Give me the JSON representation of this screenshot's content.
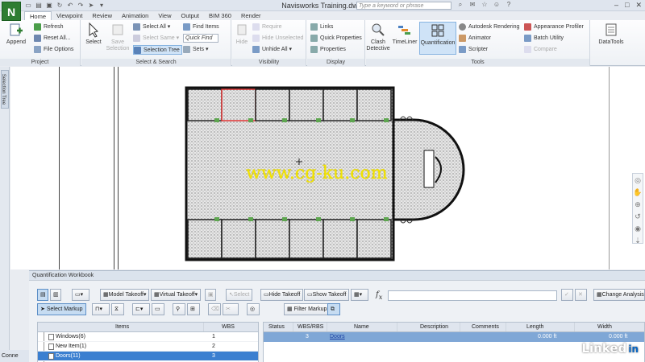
{
  "window": {
    "title": "Navisworks Training.dwfx",
    "search_placeholder": "Type a keyword or phrase",
    "app_letter": "N"
  },
  "tabs": [
    "Home",
    "Viewpoint",
    "Review",
    "Animation",
    "View",
    "Output",
    "BIM 360",
    "Render"
  ],
  "ribbon": {
    "project": {
      "label": "Project",
      "append": "Append",
      "refresh": "Refresh",
      "reset_all": "Reset All...",
      "file_options": "File Options"
    },
    "select_search": {
      "label": "Select & Search",
      "select": "Select",
      "save_selection": "Save Selection",
      "select_all": "Select All",
      "select_same": "Select Same",
      "selection_tree": "Selection Tree",
      "find_items": "Find Items",
      "quick_find": "Quick Find",
      "sets": "Sets"
    },
    "visibility": {
      "label": "Visibility",
      "hide": "Hide",
      "require": "Require",
      "hide_unselected": "Hide Unselected",
      "unhide_all": "Unhide All"
    },
    "display": {
      "label": "Display",
      "links": "Links",
      "quick_properties": "Quick Properties",
      "properties": "Properties"
    },
    "tools": {
      "label": "Tools",
      "clash_detective": "Clash Detective",
      "timeliner": "TimeLiner",
      "quantification": "Quantification",
      "autodesk_rendering": "Autodesk Rendering",
      "animator": "Animator",
      "scripter": "Scripter",
      "appearance_profiler": "Appearance Profiler",
      "batch_utility": "Batch Utility",
      "compare": "Compare",
      "datatools": "DataTools"
    }
  },
  "left_panel": {
    "selection_tree_tab": "Selection Tree"
  },
  "viewport": {
    "watermark": "www.cg-ku.com"
  },
  "workbook": {
    "title": "Quantification Workbook",
    "toolbar": {
      "model_takeoff": "Model Takeoff",
      "virtual_takeoff": "Virtual Takeoff",
      "select": "Select",
      "hide_takeoff": "Hide Takeoff",
      "show_takeoff": "Show Takeoff",
      "change_analysis": "Change Analysis",
      "select_markup": "Select Markup",
      "filter_markup": "Filter Markup"
    },
    "items_table": {
      "headers": [
        "Items",
        "WBS"
      ],
      "rows": [
        {
          "name": "Windows(6)",
          "wbs": "1"
        },
        {
          "name": "New Item(1)",
          "wbs": "2"
        },
        {
          "name": "Doors(11)",
          "wbs": "3"
        }
      ]
    },
    "detail_table": {
      "headers": [
        "Status",
        "WBS/RBS",
        "Name",
        "Description",
        "Comments",
        "Length",
        "Width"
      ],
      "rows": [
        {
          "status": "",
          "wbs": "3",
          "name": "Doors",
          "description": "",
          "comments": "",
          "length": "0.000 ft",
          "width": "0.000 ft"
        }
      ]
    }
  },
  "status": {
    "text": "Conne"
  },
  "brand": {
    "name": "Linked",
    "suffix": "in"
  }
}
